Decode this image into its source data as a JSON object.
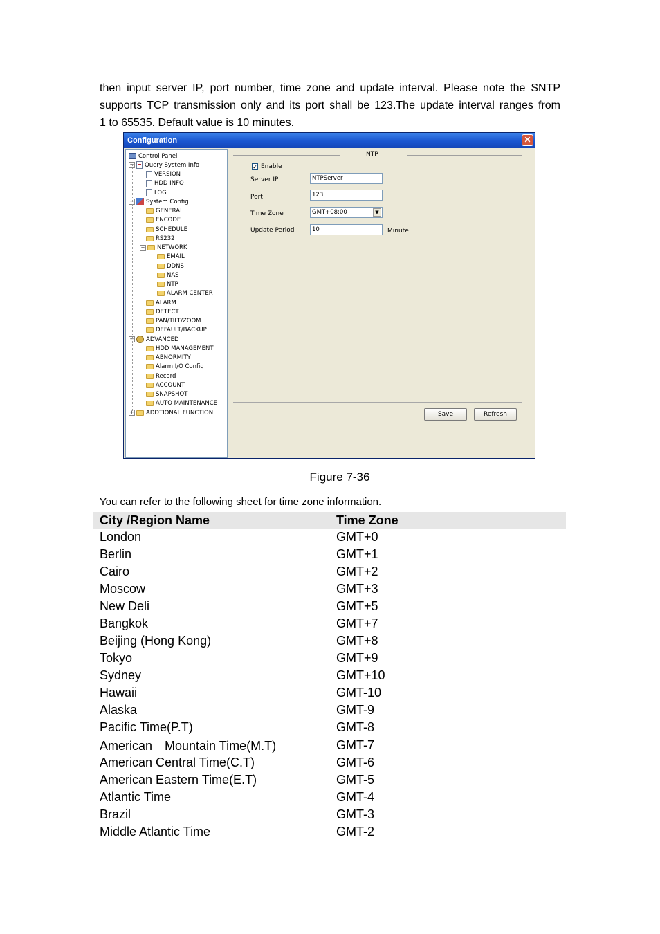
{
  "paragraph": {
    "line1": "then input server IP, port number, time zone and update interval. Please note the SNTP",
    "line2": "supports TCP transmission only and its port shall be 123.The update interval ranges from",
    "line3": "1 to 65535. Default value is 10 minutes."
  },
  "window": {
    "title": "Configuration",
    "close_glyph": "✕",
    "tree": [
      {
        "label": "Control Panel",
        "level": 0,
        "icon": "pc-icon",
        "expander": ""
      },
      {
        "label": "Query System Info",
        "level": 1,
        "icon": "doc-icon",
        "expander": "−"
      },
      {
        "label": "VERSION",
        "level": 2,
        "icon": "doc-icon",
        "expander": ""
      },
      {
        "label": "HDD INFO",
        "level": 2,
        "icon": "doc-icon",
        "expander": ""
      },
      {
        "label": "LOG",
        "level": 2,
        "icon": "doc-icon",
        "expander": ""
      },
      {
        "label": "System Config",
        "level": 1,
        "icon": "tools-icon",
        "expander": "−"
      },
      {
        "label": "GENERAL",
        "level": 2,
        "icon": "folder-icon",
        "expander": ""
      },
      {
        "label": "ENCODE",
        "level": 2,
        "icon": "folder-icon",
        "expander": ""
      },
      {
        "label": "SCHEDULE",
        "level": 2,
        "icon": "folder-icon",
        "expander": ""
      },
      {
        "label": "RS232",
        "level": 2,
        "icon": "folder-icon",
        "expander": ""
      },
      {
        "label": "NETWORK",
        "level": 2,
        "icon": "folder-icon",
        "expander": "−"
      },
      {
        "label": "EMAIL",
        "level": 3,
        "icon": "folder-icon",
        "expander": ""
      },
      {
        "label": "DDNS",
        "level": 3,
        "icon": "folder-icon",
        "expander": ""
      },
      {
        "label": "NAS",
        "level": 3,
        "icon": "folder-icon",
        "expander": ""
      },
      {
        "label": "NTP",
        "level": 3,
        "icon": "folder-icon",
        "expander": ""
      },
      {
        "label": "ALARM CENTER",
        "level": 3,
        "icon": "folder-icon",
        "expander": ""
      },
      {
        "label": "ALARM",
        "level": 2,
        "icon": "folder-icon",
        "expander": ""
      },
      {
        "label": "DETECT",
        "level": 2,
        "icon": "folder-icon",
        "expander": ""
      },
      {
        "label": "PAN/TILT/ZOOM",
        "level": 2,
        "icon": "folder-icon",
        "expander": ""
      },
      {
        "label": "DEFAULT/BACKUP",
        "level": 2,
        "icon": "folder-icon",
        "expander": ""
      },
      {
        "label": "ADVANCED",
        "level": 1,
        "icon": "gear-icon",
        "expander": "−"
      },
      {
        "label": "HDD MANAGEMENT",
        "level": 2,
        "icon": "folder-icon",
        "expander": ""
      },
      {
        "label": "ABNORMITY",
        "level": 2,
        "icon": "folder-icon",
        "expander": ""
      },
      {
        "label": "Alarm I/O Config",
        "level": 2,
        "icon": "folder-icon",
        "expander": ""
      },
      {
        "label": "Record",
        "level": 2,
        "icon": "folder-icon",
        "expander": ""
      },
      {
        "label": "ACCOUNT",
        "level": 2,
        "icon": "folder-icon",
        "expander": ""
      },
      {
        "label": "SNAPSHOT",
        "level": 2,
        "icon": "folder-icon",
        "expander": ""
      },
      {
        "label": "AUTO MAINTENANCE",
        "level": 2,
        "icon": "folder-icon",
        "expander": ""
      },
      {
        "label": "ADDTIONAL FUNCTION",
        "level": 1,
        "icon": "folder-icon",
        "expander": "+"
      }
    ],
    "ntp": {
      "group_title": "NTP",
      "enable_label": "Enable",
      "enable_checked": true,
      "check_glyph": "✓",
      "server_ip_label": "Server IP",
      "server_ip_value": "NTPServer",
      "port_label": "Port",
      "port_value": "123",
      "time_zone_label": "Time Zone",
      "time_zone_value": "GMT+08:00",
      "dropdown_glyph": "▼",
      "update_period_label": "Update Period",
      "update_period_value": "10",
      "minute_label": "Minute",
      "save_label": "Save",
      "refresh_label": "Refresh"
    }
  },
  "caption": "Figure 7-36",
  "intro": "You can refer to the following sheet for time zone information.",
  "table": {
    "headers": [
      "City /Region Name",
      "Time Zone"
    ],
    "rows": [
      [
        "London",
        "GMT+0"
      ],
      [
        "Berlin",
        "GMT+1"
      ],
      [
        "Cairo",
        "GMT+2"
      ],
      [
        "Moscow",
        "GMT+3"
      ],
      [
        "New Deli",
        "GMT+5"
      ],
      [
        "Bangkok",
        "GMT+7"
      ],
      [
        "Beijing (Hong Kong)",
        "GMT+8"
      ],
      [
        "Tokyo",
        "GMT+9"
      ],
      [
        "Sydney",
        "GMT+10"
      ],
      [
        "Hawaii",
        "GMT-10"
      ],
      [
        "Alaska",
        "GMT-9"
      ],
      [
        "Pacific Time(P.T)",
        "GMT-8"
      ],
      [
        "American　Mountain Time(M.T)",
        "GMT-7"
      ],
      [
        "American Central Time(C.T)",
        "GMT-6"
      ],
      [
        "American Eastern Time(E.T)",
        "GMT-5"
      ],
      [
        "Atlantic Time",
        "GMT-4"
      ],
      [
        "Brazil",
        "GMT-3"
      ],
      [
        "Middle Atlantic Time",
        "GMT-2"
      ]
    ]
  }
}
